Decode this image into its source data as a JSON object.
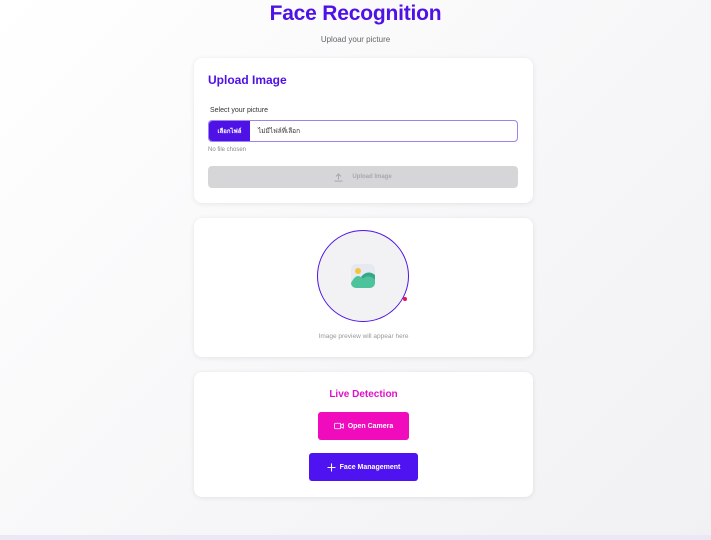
{
  "header": {
    "title": "Face Recognition",
    "subtitle": "Upload your picture"
  },
  "upload_card": {
    "title": "Upload Image",
    "field_label": "Select your picture",
    "choose_button": "เลือกไฟล์",
    "no_file_th": "ไม่มีไฟล์ที่เลือก",
    "no_file_en": "No file chosen",
    "upload_button": "Upload Image",
    "upload_icon": "upload-icon"
  },
  "preview_card": {
    "caption": "Image preview will appear here",
    "icon": "image-placeholder-icon"
  },
  "live_card": {
    "title": "Live Detection",
    "camera_button": "Open Camera",
    "camera_icon": "video-camera-icon",
    "face_button": "Face Management",
    "face_icon": "plus-icon"
  },
  "colors": {
    "primary": "#4f12e6",
    "accent": "#f00bbd",
    "disabled": "#d6d6d9"
  }
}
